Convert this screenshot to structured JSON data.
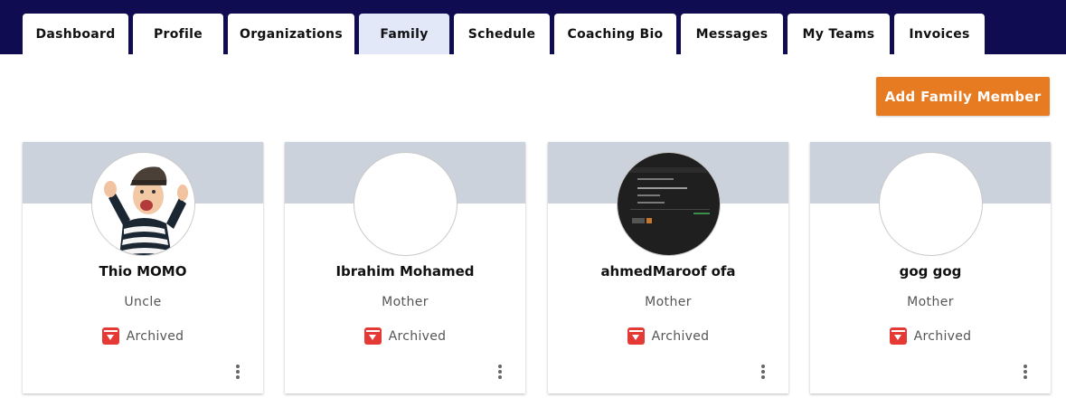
{
  "tabs": [
    {
      "label": "Dashboard",
      "active": false
    },
    {
      "label": "Profile",
      "active": false
    },
    {
      "label": "Organizations",
      "active": false
    },
    {
      "label": "Family",
      "active": true
    },
    {
      "label": "Schedule",
      "active": false
    },
    {
      "label": "Coaching Bio",
      "active": false
    },
    {
      "label": "Messages",
      "active": false
    },
    {
      "label": "My Teams",
      "active": false
    },
    {
      "label": "Invoices",
      "active": false
    }
  ],
  "actions": {
    "add_family_member_label": "Add Family Member"
  },
  "family_members": [
    {
      "name": "Thio MOMO",
      "relation": "Uncle",
      "status": "Archived",
      "avatar": "child-photo"
    },
    {
      "name": "Ibrahim Mohamed",
      "relation": "Mother",
      "status": "Archived",
      "avatar": "blank"
    },
    {
      "name": "ahmedMaroof ofa",
      "relation": "Mother",
      "status": "Archived",
      "avatar": "screenshot-photo"
    },
    {
      "name": "gog gog",
      "relation": "Mother",
      "status": "Archived",
      "avatar": "blank"
    }
  ],
  "colors": {
    "header": "#100c52",
    "active_tab": "#e3e8f8",
    "accent": "#e77b22",
    "card_band": "#cbd2db",
    "archive_icon": "#e53935"
  },
  "icons": {
    "status": "archive-icon",
    "menu": "more-vert-icon"
  }
}
